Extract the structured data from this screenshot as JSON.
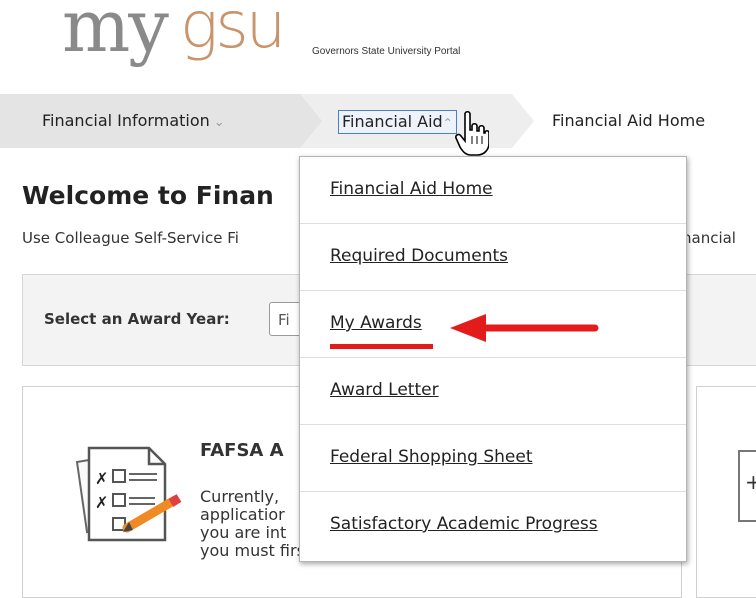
{
  "header": {
    "logo_my": "my",
    "logo_gsu": "gsu",
    "logo_subtitle": "Governors State University Portal"
  },
  "breadcrumb": {
    "items": [
      {
        "label": "Financial Information",
        "has_dropdown": true
      },
      {
        "label": "Financial Aid",
        "has_dropdown": true,
        "focused": true
      },
      {
        "label": "Financial Aid Home"
      }
    ]
  },
  "dropdown_menu": {
    "items": [
      {
        "label": "Financial Aid Home"
      },
      {
        "label": "Required Documents"
      },
      {
        "label": "My Awards",
        "highlighted_by_annotation": true
      },
      {
        "label": "Award Letter"
      },
      {
        "label": "Federal Shopping Sheet"
      },
      {
        "label": "Satisfactory Academic Progress"
      }
    ]
  },
  "main": {
    "welcome_title": "Welcome to Finan",
    "intro_left": "Use Colleague Self-Service Fi",
    "intro_right": "nancial",
    "award_year": {
      "label": "Select an Award Year:",
      "value": "Fi"
    },
    "card": {
      "title": "FAFSA A",
      "text_lines": [
        "Currently,",
        "applicatior",
        "you are int",
        "you must first."
      ]
    }
  },
  "colors": {
    "accent_logo": "#c9946a",
    "logo_gray": "#8a8a8a",
    "annotation_red": "#e31b1b",
    "focus_blue": "#4a7fd0"
  },
  "icons": [
    "chevron-down-icon",
    "chevron-up-icon",
    "hand-cursor-icon",
    "fafsa-checklist-icon",
    "red-arrow-icon"
  ]
}
